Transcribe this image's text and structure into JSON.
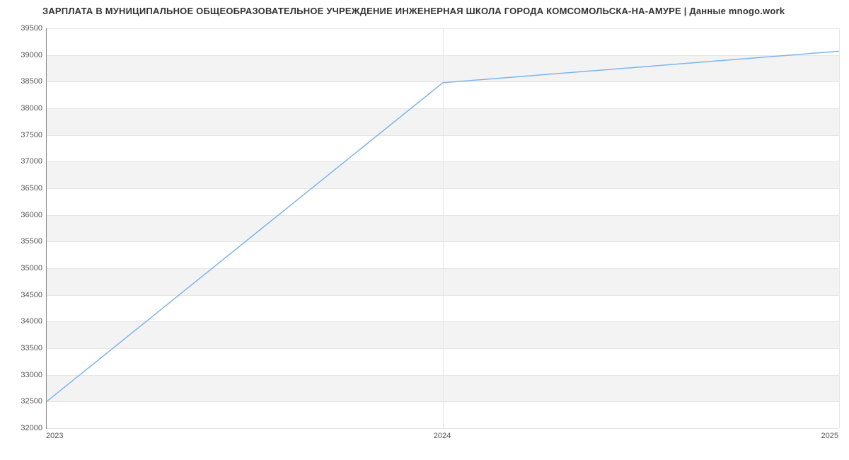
{
  "chart_data": {
    "type": "line",
    "title": "ЗАРПЛАТА В МУНИЦИПАЛЬНОЕ ОБЩЕОБРАЗОВАТЕЛЬНОЕ УЧРЕЖДЕНИЕ ИНЖЕНЕРНАЯ ШКОЛА ГОРОДА КОМСОМОЛЬСКА-НА-АМУРЕ | Данные mnogo.work",
    "x": [
      2023,
      2024,
      2025
    ],
    "x_ticks": [
      2023,
      2024,
      2025
    ],
    "values": [
      32500,
      38480,
      39070
    ],
    "y_ticks": [
      32000,
      32500,
      33000,
      33500,
      34000,
      34500,
      35000,
      35500,
      36000,
      36500,
      37000,
      37500,
      38000,
      38500,
      39000,
      39500
    ],
    "ylim": [
      32000,
      39500
    ],
    "xlim": [
      2023,
      2025
    ],
    "xlabel": "",
    "ylabel": "",
    "line_color": "#7cb5ec"
  }
}
